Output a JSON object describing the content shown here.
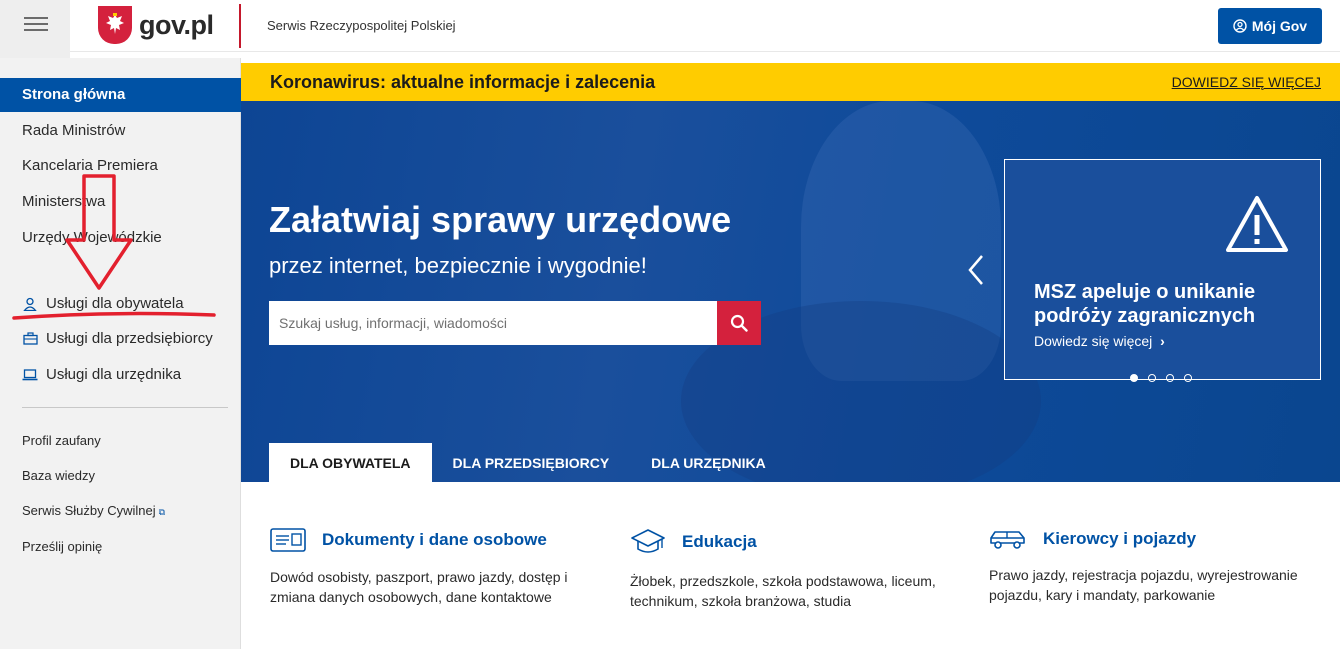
{
  "header": {
    "logo_text": "gov.pl",
    "service_name": "Serwis Rzeczypospolitej Polskiej",
    "account_button": "Mój Gov"
  },
  "sidebar": {
    "main_items": [
      {
        "label": "Strona główna",
        "active": true
      },
      {
        "label": "Rada Ministrów"
      },
      {
        "label": "Kancelaria Premiera"
      },
      {
        "label": "Ministerstwa"
      },
      {
        "label": "Urzędy Wojewódzkie"
      }
    ],
    "service_items": [
      {
        "label": "Usługi dla obywatela",
        "icon": "person-icon"
      },
      {
        "label": "Usługi dla przedsiębiorcy",
        "icon": "briefcase-icon"
      },
      {
        "label": "Usługi dla urzędnika",
        "icon": "laptop-icon"
      }
    ],
    "extra_items": [
      {
        "label": "Profil zaufany"
      },
      {
        "label": "Baza wiedzy"
      },
      {
        "label": "Serwis Służby Cywilnej",
        "external": true
      },
      {
        "label": "Prześlij opinię"
      }
    ]
  },
  "banner": {
    "title": "Koronawirus: aktualne informacje i zalecenia",
    "link": "DOWIEDZ SIĘ WIĘCEJ",
    "color": "#ffcc00"
  },
  "hero": {
    "title": "Załatwiaj sprawy urzędowe",
    "subtitle": "przez internet, bezpiecznie i wygodnie!",
    "search_placeholder": "Szukaj usług, informacji, wiadomości",
    "tabs": [
      "DLA OBYWATELA",
      "DLA PRZEDSIĘBIORCY",
      "DLA URZĘDNIKA"
    ],
    "active_tab": 0
  },
  "carousel": {
    "card_title": "MSZ apeluje o unikanie podróży zagranicznych",
    "card_link": "Dowiedz się więcej",
    "icon": "warning-icon",
    "slide_count": 4,
    "active_slide": 1
  },
  "categories": [
    {
      "title": "Dokumenty i dane osobowe",
      "icon": "id-card-icon",
      "description": "Dowód osobisty, paszport, prawo jazdy, dostęp i zmiana danych osobowych, dane kontaktowe"
    },
    {
      "title": "Edukacja",
      "icon": "graduation-cap-icon",
      "description": "Żłobek, przedszkole, szkoła podstawowa, liceum, technikum, szkoła branżowa, studia"
    },
    {
      "title": "Kierowcy i pojazdy",
      "icon": "car-icon",
      "description": "Prawo jazdy, rejestracja pojazdu, wyrejestrowanie pojazdu, kary i mandaty, parkowanie"
    }
  ],
  "colors": {
    "brand_blue": "#0052a5",
    "brand_red": "#d4213d",
    "annotation_red": "#e3202e"
  }
}
